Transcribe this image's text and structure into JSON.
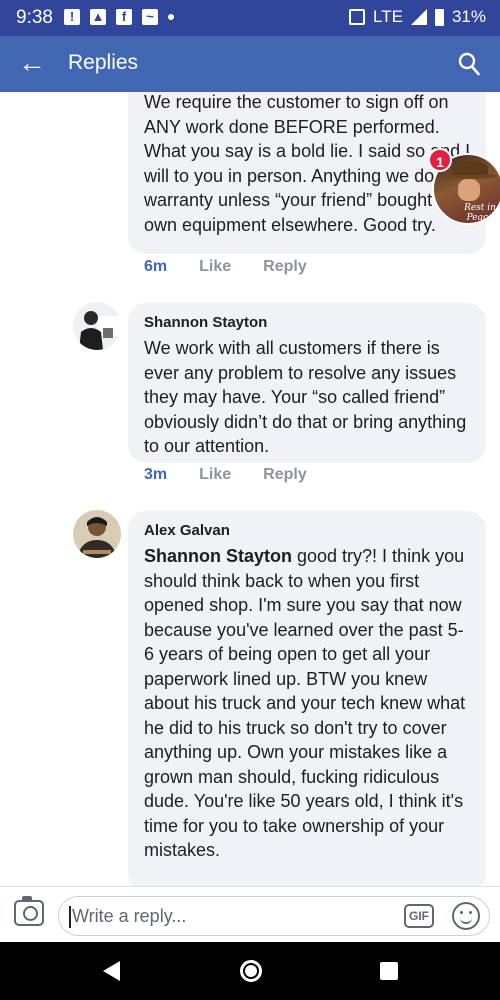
{
  "status_bar": {
    "time": "9:38",
    "network": "LTE",
    "battery": "31%"
  },
  "app_bar": {
    "title": "Replies",
    "back_icon": "arrow-left-icon",
    "search_icon": "search-icon"
  },
  "comments": [
    {
      "author": "",
      "text": "We require the customer to sign off on ANY work done BEFORE performed. What you say is a bold lie. I said so and I will to you in person. Anything we do we warranty unless “your friend” bought his own equipment elsewhere. Good try.",
      "time": "6m",
      "like": "Like",
      "reply": "Reply"
    },
    {
      "author": "Shannon Stayton",
      "text": "We work with all customers if there is ever any problem to resolve any issues they may have. Your “so called friend” obviously didn’t do that or bring anything to our attention.",
      "time": "3m",
      "like": "Like",
      "reply": "Reply"
    },
    {
      "author": "Alex Galvan",
      "mention": "Shannon Stayton",
      "text": " good try?! I think you should think back to when you first opened shop. I'm sure you say that now because you've learned over the past 5-6 years of being open to get all your paperwork lined up. BTW you knew about his truck and your tech knew what he did to his truck so don't try to cover anything up. Own your mistakes like a grown man should, fucking ridiculous dude. You're like 50 years old, I think it's time for you to take ownership of your mistakes."
    }
  ],
  "chat_head": {
    "badge": "1",
    "caption": "Rest in Peace Tyler E"
  },
  "composer": {
    "placeholder": "Write a reply...",
    "gif_label": "GIF"
  },
  "colors": {
    "status_bar": "#30469a",
    "app_bar": "#4267b2",
    "bubble": "#f0f2f5",
    "badge": "#e41e3f"
  }
}
